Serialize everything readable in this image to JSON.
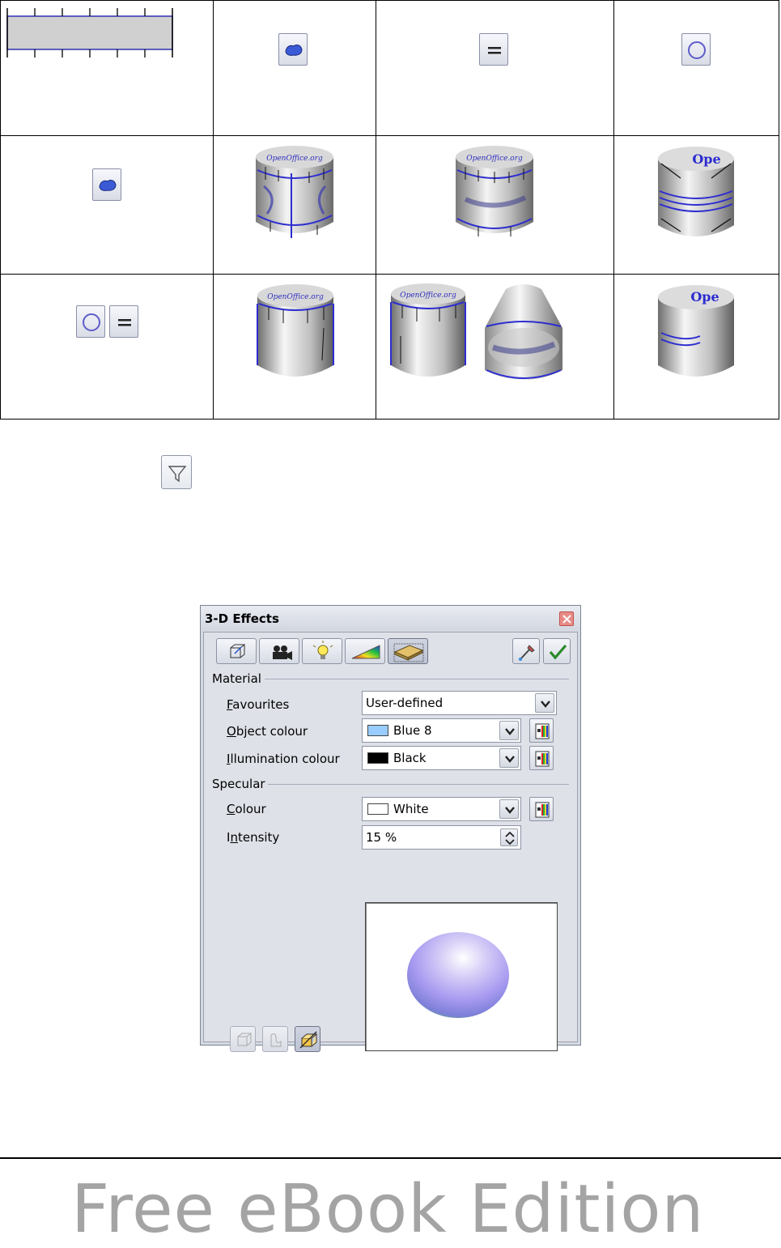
{
  "dialog": {
    "title": "3-D Effects",
    "tabs": [
      {
        "icon": "geometry-icon"
      },
      {
        "icon": "shading-icon"
      },
      {
        "icon": "illumination-icon"
      },
      {
        "icon": "textures-icon"
      },
      {
        "icon": "material-icon",
        "active": true
      }
    ],
    "tools": [
      {
        "icon": "pick-color-icon"
      },
      {
        "icon": "assign-checkmark-icon"
      }
    ],
    "material_section": "Material",
    "favourites": {
      "label_prefix": "",
      "label_accel": "F",
      "label_rest": "avourites",
      "value": "User-defined"
    },
    "object_colour": {
      "label_accel": "O",
      "label_rest": "bject colour",
      "value": "Blue 8",
      "swatch": "#99ccff"
    },
    "illumination_colour": {
      "label_accel": "I",
      "label_rest": "llumination colour",
      "value": "Black",
      "swatch": "#000000"
    },
    "specular_section": "Specular",
    "colour": {
      "label_accel": "C",
      "label_rest": "olour",
      "value": "White",
      "swatch": "#ffffff"
    },
    "intensity": {
      "label_start": "I",
      "label_accel": "n",
      "label_rest": "tensity",
      "value": "15 %"
    },
    "bottom_buttons": [
      {
        "icon": "convert-to-3d-icon",
        "enabled": false
      },
      {
        "icon": "convert-to-lathe-icon",
        "enabled": false
      },
      {
        "icon": "perspective-on-off-icon",
        "enabled": true
      }
    ],
    "preview_sphere_colors": [
      "#ffffff",
      "#b9a7f2",
      "#7f7fe6",
      "#5fb48a"
    ]
  },
  "table": {
    "button_icons": [
      "fontwork-shape-icon",
      "fontwork-shape-icon",
      "same-letter-heights-icon",
      "fontwork-shape-circle-icon",
      "same-letter-heights-icon"
    ],
    "cylinder_labels": [
      "OpenOffice.org",
      "OpenOffice.org",
      "Ope"
    ]
  },
  "footer": {
    "text": "Free eBook Edition"
  }
}
